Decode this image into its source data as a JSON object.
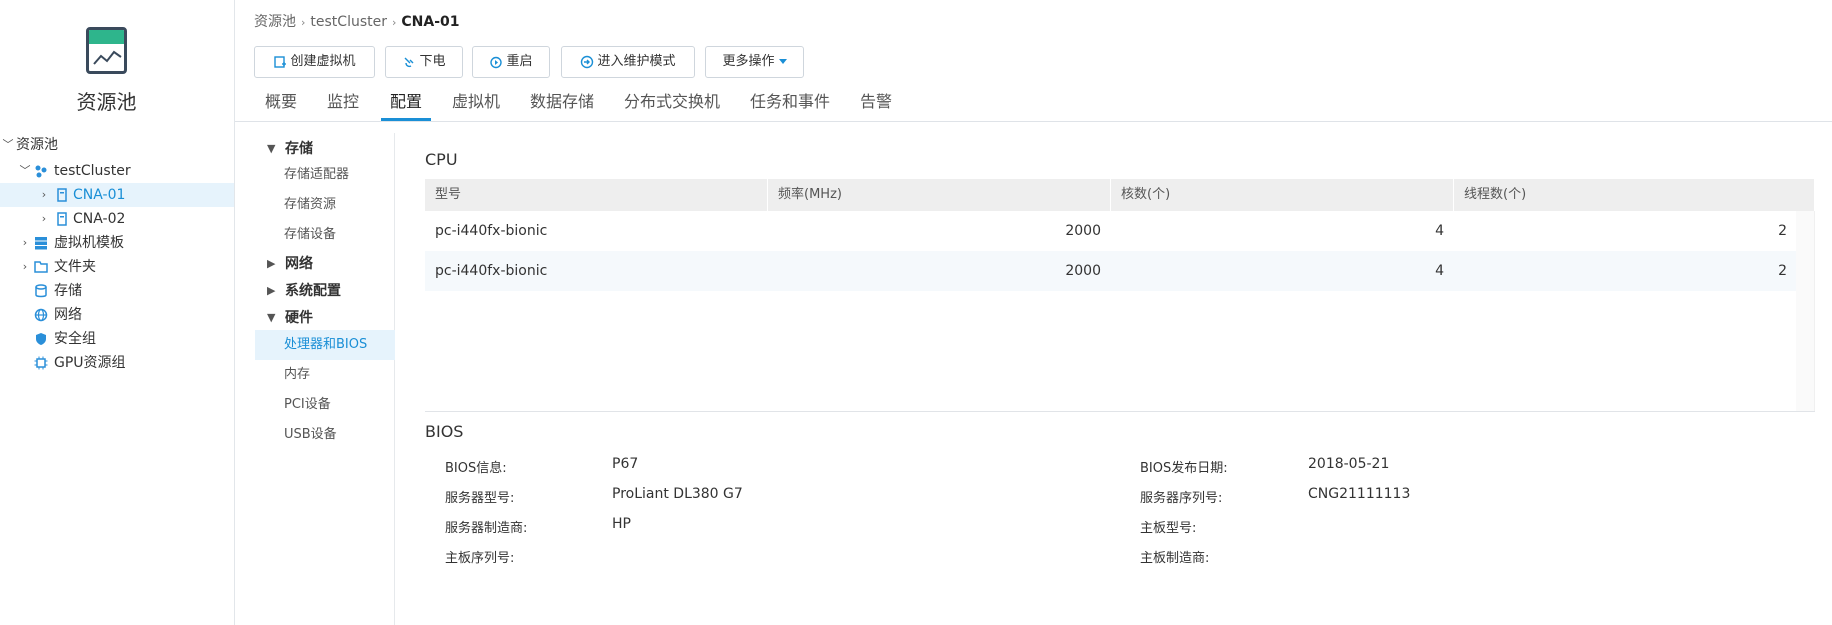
{
  "sidebar": {
    "title": "资源池",
    "tree": [
      {
        "label": "资源池",
        "icon": "collapse-chevron"
      },
      {
        "label": "testCluster",
        "icon": "cluster-icon"
      },
      {
        "label": "CNA-01",
        "icon": "host-icon",
        "selected": true
      },
      {
        "label": "CNA-02",
        "icon": "host-icon"
      },
      {
        "label": "虚拟机模板",
        "icon": "template-icon"
      },
      {
        "label": "文件夹",
        "icon": "folder-icon"
      },
      {
        "label": "存储",
        "icon": "storage-icon"
      },
      {
        "label": "网络",
        "icon": "network-icon"
      },
      {
        "label": "安全组",
        "icon": "security-group-icon"
      },
      {
        "label": "GPU资源组",
        "icon": "gpu-icon"
      }
    ]
  },
  "breadcrumb": [
    "资源池",
    "testCluster",
    "CNA-01"
  ],
  "toolbar": {
    "create_vm": "创建虚拟机",
    "power_off": "下电",
    "restart": "重启",
    "maintenance": "进入维护模式",
    "more": "更多操作"
  },
  "tabs": [
    "概要",
    "监控",
    "配置",
    "虚拟机",
    "数据存储",
    "分布式交换机",
    "任务和事件",
    "告警"
  ],
  "active_tab": "配置",
  "subnav": {
    "storage": {
      "label": "存储",
      "items": [
        "存储适配器",
        "存储资源",
        "存储设备"
      ]
    },
    "network": {
      "label": "网络"
    },
    "system": {
      "label": "系统配置"
    },
    "hardware": {
      "label": "硬件",
      "items": [
        "处理器和BIOS",
        "内存",
        "PCI设备",
        "USB设备"
      ]
    },
    "active_item": "处理器和BIOS"
  },
  "cpu": {
    "title": "CPU",
    "columns": [
      "型号",
      "频率(MHz)",
      "核数(个)",
      "线程数(个)"
    ],
    "rows": [
      {
        "model": "pc-i440fx-bionic",
        "freq": "2000",
        "cores": "4",
        "threads": "2"
      },
      {
        "model": "pc-i440fx-bionic",
        "freq": "2000",
        "cores": "4",
        "threads": "2"
      }
    ]
  },
  "bios": {
    "title": "BIOS",
    "bios_info_label": "BIOS信息:",
    "bios_info_value": "P67",
    "bios_date_label": "BIOS发布日期:",
    "bios_date_value": "2018-05-21",
    "server_model_label": "服务器型号:",
    "server_model_value": "ProLiant DL380 G7",
    "server_serial_label": "服务器序列号:",
    "server_serial_value": "CNG21111113",
    "server_vendor_label": "服务器制造商:",
    "server_vendor_value": "HP",
    "board_model_label": "主板型号:",
    "board_model_value": "",
    "board_serial_label": "主板序列号:",
    "board_serial_value": "",
    "board_vendor_label": "主板制造商:",
    "board_vendor_value": ""
  },
  "colors": {
    "accent": "#1a8fd6",
    "logo_green": "#2eb58c",
    "selected_bg": "#e6f3fc"
  }
}
